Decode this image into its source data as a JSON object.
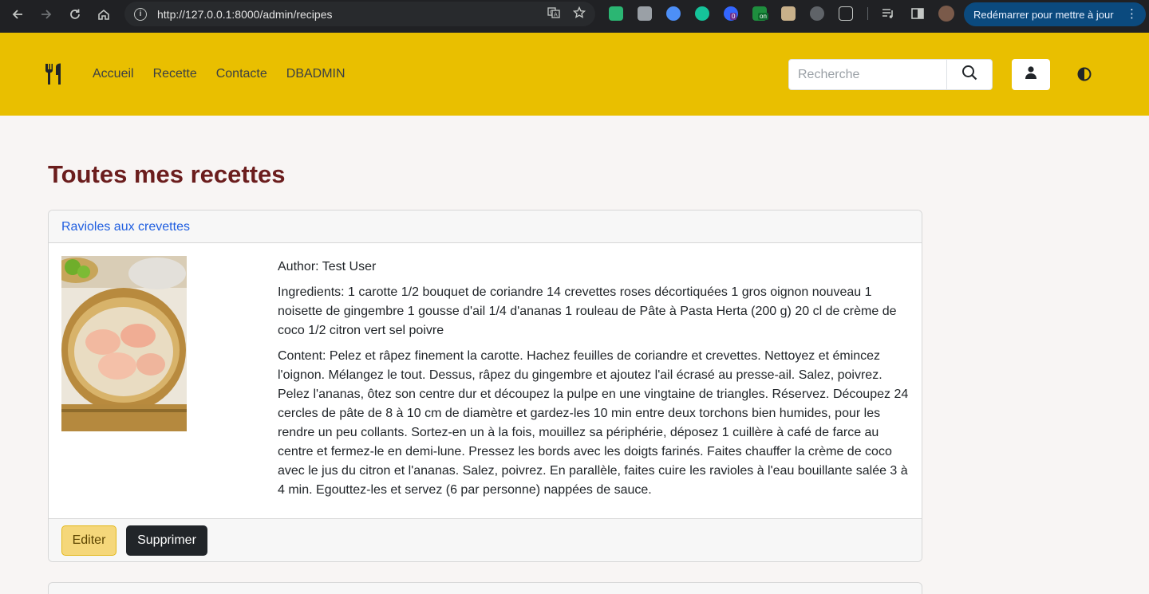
{
  "browser": {
    "url": "http://127.0.0.1:8000/admin/recipes",
    "update_label": "Redémarrer pour mettre à jour",
    "icons": [
      "back-arrow-icon",
      "forward-arrow-icon",
      "reload-icon",
      "home-icon",
      "site-info-icon",
      "translate-icon",
      "bookmark-star-icon",
      "extensions-icon",
      "reading-list-icon",
      "side-panel-icon",
      "profile-avatar-icon",
      "more-menu-icon"
    ],
    "ext_badge_0": "0",
    "ext_badge_on": "on"
  },
  "navbar": {
    "bg_color": "#e9bf00",
    "brand_icon": "utensils-icon",
    "links": [
      "Accueil",
      "Recette",
      "Contacte",
      "DBADMIN"
    ],
    "search_placeholder": "Recherche",
    "search_icon": "search-icon",
    "user_icon": "user-icon",
    "theme_icon": "contrast-icon"
  },
  "main": {
    "title": "Toutes mes recettes",
    "title_color": "#6b1d1d",
    "recipe": {
      "name": "Ravioles aux crevettes",
      "author": "Author: Test User",
      "ingredients": "Ingredients: 1 carotte 1/2 bouquet de coriandre 14 crevettes roses décortiquées 1 gros oignon nouveau 1 noisette de gingembre 1 gousse d'ail 1/4 d'ananas 1 rouleau de Pâte à Pasta Herta (200 g) 20 cl de crème de coco 1/2 citron vert sel poivre",
      "content": "Content: Pelez et râpez finement la carotte. Hachez feuilles de coriandre et crevettes. Nettoyez et émincez l'oignon. Mélangez le tout. Dessus, râpez du gingembre et ajoutez l'ail écrasé au presse-ail. Salez, poivrez. Pelez l'ananas, ôtez son centre dur et découpez la pulpe en une vingtaine de triangles. Réservez. Découpez 24 cercles de pâte de 8 à 10 cm de diamètre et gardez-les 10 min entre deux torchons bien humides, pour les rendre un peu collants. Sortez-en un à la fois, mouillez sa périphérie, déposez 1 cuillère à café de farce au centre et fermez-le en demi-lune. Pressez les bords avec les doigts farinés. Faites chauffer la crème de coco avec le jus du citron et l'ananas. Salez, poivrez. En parallèle, faites cuire les ravioles à l'eau bouillante salée 3 à 4 min. Egouttez-les et servez (6 par personne) nappées de sauce.",
      "edit_label": "Editer",
      "delete_label": "Supprimer",
      "edit_color": "#f5d77a",
      "delete_color": "#212529"
    }
  }
}
